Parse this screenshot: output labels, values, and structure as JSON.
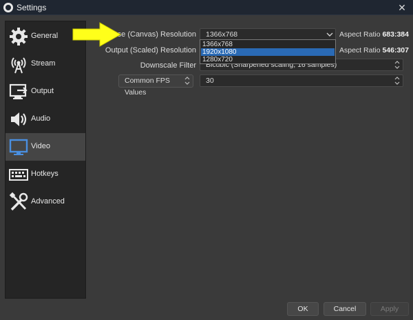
{
  "window": {
    "title": "Settings",
    "close_glyph": "✕"
  },
  "sidebar": {
    "items": [
      {
        "label": "General",
        "icon": "gear-icon"
      },
      {
        "label": "Stream",
        "icon": "broadcast-icon"
      },
      {
        "label": "Output",
        "icon": "output-monitor-icon"
      },
      {
        "label": "Audio",
        "icon": "speaker-icon"
      },
      {
        "label": "Video",
        "icon": "monitor-icon",
        "selected": true
      },
      {
        "label": "Hotkeys",
        "icon": "keyboard-icon"
      },
      {
        "label": "Advanced",
        "icon": "tools-icon"
      }
    ]
  },
  "video": {
    "base_label": "Base (Canvas) Resolution",
    "base_value": "1366x768",
    "base_aspect_label": "Aspect Ratio",
    "base_aspect_value": "683:384",
    "output_label": "Output (Scaled) Resolution",
    "output_aspect_label": "Aspect Ratio",
    "output_aspect_value": "546:307",
    "downscale_label": "Downscale Filter",
    "downscale_value": "Bicubic (Sharpened scaling, 16 samples)",
    "fps_type_label": "Common FPS Values",
    "fps_value": "30",
    "dropdown_options": [
      "1366x768",
      "1920x1080",
      "1280x720"
    ],
    "dropdown_highlighted": "1920x1080"
  },
  "footer": {
    "ok": "OK",
    "cancel": "Cancel",
    "apply": "Apply"
  },
  "colors": {
    "selection_blue": "#2a6ab5",
    "annotation_arrow": "#ffff1a"
  }
}
